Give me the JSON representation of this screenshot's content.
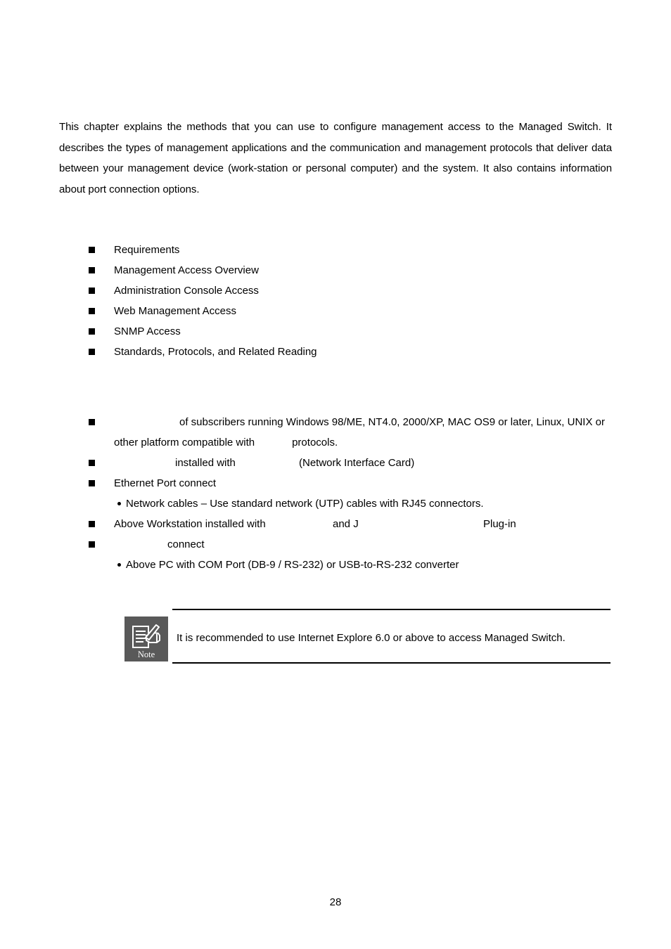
{
  "document": {
    "page_number": "28"
  },
  "intro": {
    "paragraph": "This chapter explains the methods that you can use to configure management access to the Managed Switch. It describes the types of management applications and the communication and management protocols that deliver data between your management device (work-station or personal computer) and the system. It also contains information about port connection options."
  },
  "contents": {
    "items": [
      {
        "label": "Requirements"
      },
      {
        "label": "Management Access Overview"
      },
      {
        "label": "Administration Console Access"
      },
      {
        "label": "Web Management Access"
      },
      {
        "label": "SNMP Access"
      },
      {
        "label": "Standards, Protocols, and Related Reading"
      }
    ]
  },
  "requirements": {
    "item1": {
      "text_after_gap": "of subscribers running Windows 98/ME, NT4.0, 2000/XP, MAC OS9 or later, Linux, UNIX or",
      "wrap_prefix": "other platform compatible with",
      "wrap_suffix": "protocols."
    },
    "item2": {
      "text_a": "installed with",
      "text_b": "(Network Interface Card)"
    },
    "item3": {
      "text": "Ethernet Port connect"
    },
    "subitem_network_cables": {
      "text": "Network cables – Use standard network (UTP) cables with RJ45 connectors."
    },
    "item4": {
      "text_a": "Above Workstation installed with",
      "text_b": "and J",
      "text_c": "Plug-in"
    },
    "item5": {
      "text": "connect"
    },
    "subitem_com_port": {
      "text": "Above PC with COM Port (DB-9 / RS-232) or USB-to-RS-232 converter"
    }
  },
  "note": {
    "icon_label": "Note",
    "icon_name": "note-pen-document-icon",
    "text": "It is recommended to use Internet Explore 6.0 or above to access Managed Switch.",
    "icon_background": "#595959",
    "icon_foreground": "#ffffff"
  }
}
